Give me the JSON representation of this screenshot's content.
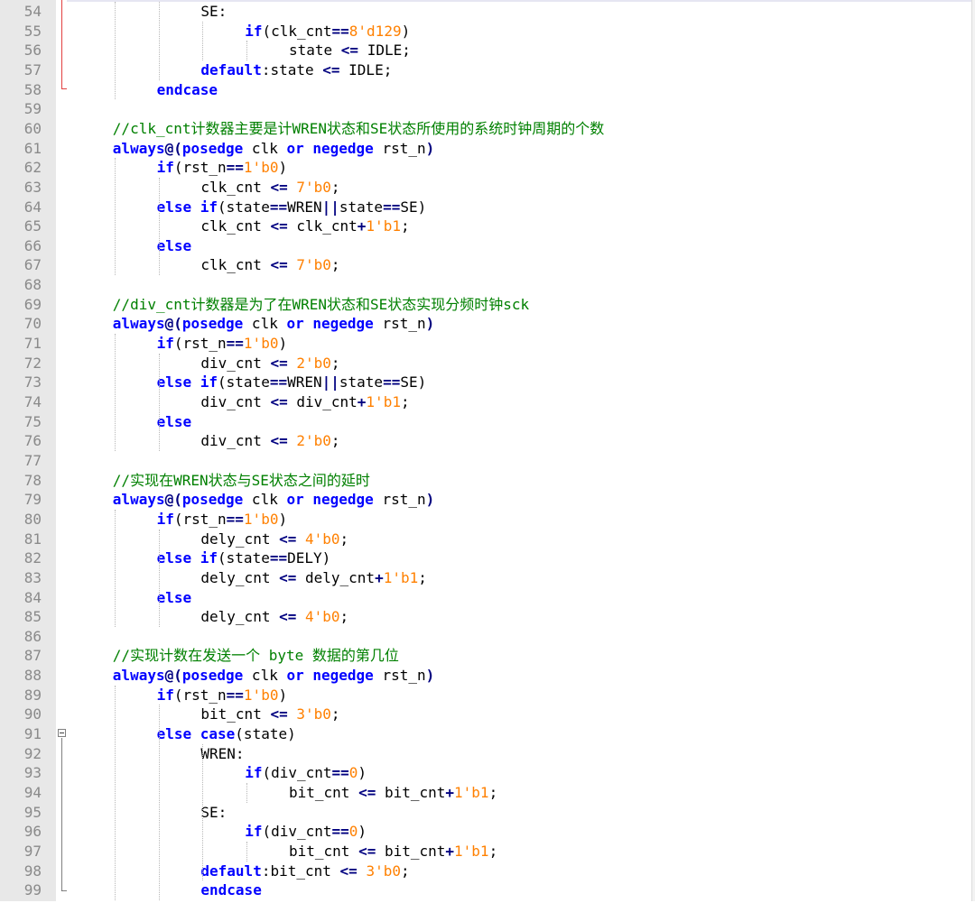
{
  "editor": {
    "language": "Verilog",
    "colors": {
      "keyword": "#0000ff",
      "operator": "#000080",
      "number": "#ff8000",
      "comment": "#008000",
      "line_number": "#8a8a8a",
      "gutter_bg": "#e8e8e8"
    },
    "lines": [
      {
        "n": "54",
        "indent": 6,
        "tokens": [
          {
            "t": "SE:",
            "c": "id"
          }
        ]
      },
      {
        "n": "55",
        "indent": 8,
        "tokens": [
          {
            "t": "if",
            "c": "kw"
          },
          {
            "t": "(clk_cnt",
            "c": "id"
          },
          {
            "t": "==",
            "c": "op"
          },
          {
            "t": "8'd129",
            "c": "num"
          },
          {
            "t": ")",
            "c": "id"
          }
        ]
      },
      {
        "n": "56",
        "indent": 10,
        "tokens": [
          {
            "t": "state ",
            "c": "id"
          },
          {
            "t": "<=",
            "c": "op"
          },
          {
            "t": " IDLE;",
            "c": "id"
          }
        ]
      },
      {
        "n": "57",
        "indent": 6,
        "tokens": [
          {
            "t": "default",
            "c": "kw"
          },
          {
            "t": ":state ",
            "c": "id"
          },
          {
            "t": "<=",
            "c": "op"
          },
          {
            "t": " IDLE;",
            "c": "id"
          }
        ]
      },
      {
        "n": "58",
        "indent": 4,
        "tokens": [
          {
            "t": "endcase",
            "c": "kw"
          }
        ]
      },
      {
        "n": "59",
        "indent": 0,
        "tokens": []
      },
      {
        "n": "60",
        "indent": 2,
        "tokens": [
          {
            "t": "//clk_cnt计数器主要是计WREN状态和SE状态所使用的系统时钟周期的个数",
            "c": "cm"
          }
        ]
      },
      {
        "n": "61",
        "indent": 2,
        "tokens": [
          {
            "t": "always",
            "c": "kw"
          },
          {
            "t": "@(",
            "c": "op"
          },
          {
            "t": "posedge",
            "c": "kw"
          },
          {
            "t": " clk ",
            "c": "id"
          },
          {
            "t": "or",
            "c": "kw"
          },
          {
            "t": " ",
            "c": "id"
          },
          {
            "t": "negedge",
            "c": "kw"
          },
          {
            "t": " rst_n",
            "c": "id"
          },
          {
            "t": ")",
            "c": "op"
          }
        ]
      },
      {
        "n": "62",
        "indent": 4,
        "tokens": [
          {
            "t": "if",
            "c": "kw"
          },
          {
            "t": "(rst_n",
            "c": "id"
          },
          {
            "t": "==",
            "c": "op"
          },
          {
            "t": "1'b0",
            "c": "num"
          },
          {
            "t": ")",
            "c": "id"
          }
        ]
      },
      {
        "n": "63",
        "indent": 6,
        "tokens": [
          {
            "t": "clk_cnt ",
            "c": "id"
          },
          {
            "t": "<=",
            "c": "op"
          },
          {
            "t": " ",
            "c": "id"
          },
          {
            "t": "7'b0",
            "c": "num"
          },
          {
            "t": ";",
            "c": "id"
          }
        ]
      },
      {
        "n": "64",
        "indent": 4,
        "tokens": [
          {
            "t": "else",
            "c": "kw"
          },
          {
            "t": " ",
            "c": "id"
          },
          {
            "t": "if",
            "c": "kw"
          },
          {
            "t": "(state",
            "c": "id"
          },
          {
            "t": "==",
            "c": "op"
          },
          {
            "t": "WREN",
            "c": "id"
          },
          {
            "t": "||",
            "c": "op"
          },
          {
            "t": "state",
            "c": "id"
          },
          {
            "t": "==",
            "c": "op"
          },
          {
            "t": "SE)",
            "c": "id"
          }
        ]
      },
      {
        "n": "65",
        "indent": 6,
        "tokens": [
          {
            "t": "clk_cnt ",
            "c": "id"
          },
          {
            "t": "<=",
            "c": "op"
          },
          {
            "t": " clk_cnt",
            "c": "id"
          },
          {
            "t": "+",
            "c": "op"
          },
          {
            "t": "1'b1",
            "c": "num"
          },
          {
            "t": ";",
            "c": "id"
          }
        ]
      },
      {
        "n": "66",
        "indent": 4,
        "tokens": [
          {
            "t": "else",
            "c": "kw"
          }
        ]
      },
      {
        "n": "67",
        "indent": 6,
        "tokens": [
          {
            "t": "clk_cnt ",
            "c": "id"
          },
          {
            "t": "<=",
            "c": "op"
          },
          {
            "t": " ",
            "c": "id"
          },
          {
            "t": "7'b0",
            "c": "num"
          },
          {
            "t": ";",
            "c": "id"
          }
        ]
      },
      {
        "n": "68",
        "indent": 0,
        "tokens": []
      },
      {
        "n": "69",
        "indent": 2,
        "tokens": [
          {
            "t": "//div_cnt计数器是为了在WREN状态和SE状态实现分频时钟sck",
            "c": "cm"
          }
        ]
      },
      {
        "n": "70",
        "indent": 2,
        "tokens": [
          {
            "t": "always",
            "c": "kw"
          },
          {
            "t": "@(",
            "c": "op"
          },
          {
            "t": "posedge",
            "c": "kw"
          },
          {
            "t": " clk ",
            "c": "id"
          },
          {
            "t": "or",
            "c": "kw"
          },
          {
            "t": " ",
            "c": "id"
          },
          {
            "t": "negedge",
            "c": "kw"
          },
          {
            "t": " rst_n",
            "c": "id"
          },
          {
            "t": ")",
            "c": "op"
          }
        ]
      },
      {
        "n": "71",
        "indent": 4,
        "tokens": [
          {
            "t": "if",
            "c": "kw"
          },
          {
            "t": "(rst_n",
            "c": "id"
          },
          {
            "t": "==",
            "c": "op"
          },
          {
            "t": "1'b0",
            "c": "num"
          },
          {
            "t": ")",
            "c": "id"
          }
        ]
      },
      {
        "n": "72",
        "indent": 6,
        "tokens": [
          {
            "t": "div_cnt ",
            "c": "id"
          },
          {
            "t": "<=",
            "c": "op"
          },
          {
            "t": " ",
            "c": "id"
          },
          {
            "t": "2'b0",
            "c": "num"
          },
          {
            "t": ";",
            "c": "id"
          }
        ]
      },
      {
        "n": "73",
        "indent": 4,
        "tokens": [
          {
            "t": "else",
            "c": "kw"
          },
          {
            "t": " ",
            "c": "id"
          },
          {
            "t": "if",
            "c": "kw"
          },
          {
            "t": "(state",
            "c": "id"
          },
          {
            "t": "==",
            "c": "op"
          },
          {
            "t": "WREN",
            "c": "id"
          },
          {
            "t": "||",
            "c": "op"
          },
          {
            "t": "state",
            "c": "id"
          },
          {
            "t": "==",
            "c": "op"
          },
          {
            "t": "SE)",
            "c": "id"
          }
        ]
      },
      {
        "n": "74",
        "indent": 6,
        "tokens": [
          {
            "t": "div_cnt ",
            "c": "id"
          },
          {
            "t": "<=",
            "c": "op"
          },
          {
            "t": " div_cnt",
            "c": "id"
          },
          {
            "t": "+",
            "c": "op"
          },
          {
            "t": "1'b1",
            "c": "num"
          },
          {
            "t": ";",
            "c": "id"
          }
        ]
      },
      {
        "n": "75",
        "indent": 4,
        "tokens": [
          {
            "t": "else",
            "c": "kw"
          }
        ]
      },
      {
        "n": "76",
        "indent": 6,
        "tokens": [
          {
            "t": "div_cnt ",
            "c": "id"
          },
          {
            "t": "<=",
            "c": "op"
          },
          {
            "t": " ",
            "c": "id"
          },
          {
            "t": "2'b0",
            "c": "num"
          },
          {
            "t": ";",
            "c": "id"
          }
        ]
      },
      {
        "n": "77",
        "indent": 0,
        "tokens": []
      },
      {
        "n": "78",
        "indent": 2,
        "tokens": [
          {
            "t": "//实现在WREN状态与SE状态之间的延时",
            "c": "cm"
          }
        ]
      },
      {
        "n": "79",
        "indent": 2,
        "tokens": [
          {
            "t": "always",
            "c": "kw"
          },
          {
            "t": "@(",
            "c": "op"
          },
          {
            "t": "posedge",
            "c": "kw"
          },
          {
            "t": " clk ",
            "c": "id"
          },
          {
            "t": "or",
            "c": "kw"
          },
          {
            "t": " ",
            "c": "id"
          },
          {
            "t": "negedge",
            "c": "kw"
          },
          {
            "t": " rst_n",
            "c": "id"
          },
          {
            "t": ")",
            "c": "op"
          }
        ]
      },
      {
        "n": "80",
        "indent": 4,
        "tokens": [
          {
            "t": "if",
            "c": "kw"
          },
          {
            "t": "(rst_n",
            "c": "id"
          },
          {
            "t": "==",
            "c": "op"
          },
          {
            "t": "1'b0",
            "c": "num"
          },
          {
            "t": ")",
            "c": "id"
          }
        ]
      },
      {
        "n": "81",
        "indent": 6,
        "tokens": [
          {
            "t": "dely_cnt ",
            "c": "id"
          },
          {
            "t": "<=",
            "c": "op"
          },
          {
            "t": " ",
            "c": "id"
          },
          {
            "t": "4'b0",
            "c": "num"
          },
          {
            "t": ";",
            "c": "id"
          }
        ]
      },
      {
        "n": "82",
        "indent": 4,
        "tokens": [
          {
            "t": "else",
            "c": "kw"
          },
          {
            "t": " ",
            "c": "id"
          },
          {
            "t": "if",
            "c": "kw"
          },
          {
            "t": "(state",
            "c": "id"
          },
          {
            "t": "==",
            "c": "op"
          },
          {
            "t": "DELY)",
            "c": "id"
          }
        ]
      },
      {
        "n": "83",
        "indent": 6,
        "tokens": [
          {
            "t": "dely_cnt ",
            "c": "id"
          },
          {
            "t": "<=",
            "c": "op"
          },
          {
            "t": " dely_cnt",
            "c": "id"
          },
          {
            "t": "+",
            "c": "op"
          },
          {
            "t": "1'b1",
            "c": "num"
          },
          {
            "t": ";",
            "c": "id"
          }
        ]
      },
      {
        "n": "84",
        "indent": 4,
        "tokens": [
          {
            "t": "else",
            "c": "kw"
          }
        ]
      },
      {
        "n": "85",
        "indent": 6,
        "tokens": [
          {
            "t": "dely_cnt ",
            "c": "id"
          },
          {
            "t": "<=",
            "c": "op"
          },
          {
            "t": " ",
            "c": "id"
          },
          {
            "t": "4'b0",
            "c": "num"
          },
          {
            "t": ";",
            "c": "id"
          }
        ]
      },
      {
        "n": "86",
        "indent": 0,
        "tokens": []
      },
      {
        "n": "87",
        "indent": 2,
        "tokens": [
          {
            "t": "//实现计数在发送一个 byte 数据的第几位",
            "c": "cm"
          }
        ]
      },
      {
        "n": "88",
        "indent": 2,
        "tokens": [
          {
            "t": "always",
            "c": "kw"
          },
          {
            "t": "@(",
            "c": "op"
          },
          {
            "t": "posedge",
            "c": "kw"
          },
          {
            "t": " clk ",
            "c": "id"
          },
          {
            "t": "or",
            "c": "kw"
          },
          {
            "t": " ",
            "c": "id"
          },
          {
            "t": "negedge",
            "c": "kw"
          },
          {
            "t": " rst_n",
            "c": "id"
          },
          {
            "t": ")",
            "c": "op"
          }
        ]
      },
      {
        "n": "89",
        "indent": 4,
        "tokens": [
          {
            "t": "if",
            "c": "kw"
          },
          {
            "t": "(rst_n",
            "c": "id"
          },
          {
            "t": "==",
            "c": "op"
          },
          {
            "t": "1'b0",
            "c": "num"
          },
          {
            "t": ")",
            "c": "id"
          }
        ]
      },
      {
        "n": "90",
        "indent": 6,
        "tokens": [
          {
            "t": "bit_cnt ",
            "c": "id"
          },
          {
            "t": "<=",
            "c": "op"
          },
          {
            "t": " ",
            "c": "id"
          },
          {
            "t": "3'b0",
            "c": "num"
          },
          {
            "t": ";",
            "c": "id"
          }
        ]
      },
      {
        "n": "91",
        "indent": 4,
        "tokens": [
          {
            "t": "else",
            "c": "kw"
          },
          {
            "t": " ",
            "c": "id"
          },
          {
            "t": "case",
            "c": "kw"
          },
          {
            "t": "(state)",
            "c": "id"
          }
        ]
      },
      {
        "n": "92",
        "indent": 6,
        "tokens": [
          {
            "t": "WREN:",
            "c": "id"
          }
        ]
      },
      {
        "n": "93",
        "indent": 8,
        "tokens": [
          {
            "t": "if",
            "c": "kw"
          },
          {
            "t": "(div_cnt",
            "c": "id"
          },
          {
            "t": "==",
            "c": "op"
          },
          {
            "t": "0",
            "c": "num"
          },
          {
            "t": ")",
            "c": "id"
          }
        ]
      },
      {
        "n": "94",
        "indent": 10,
        "tokens": [
          {
            "t": "bit_cnt ",
            "c": "id"
          },
          {
            "t": "<=",
            "c": "op"
          },
          {
            "t": " bit_cnt",
            "c": "id"
          },
          {
            "t": "+",
            "c": "op"
          },
          {
            "t": "1'b1",
            "c": "num"
          },
          {
            "t": ";",
            "c": "id"
          }
        ]
      },
      {
        "n": "95",
        "indent": 6,
        "tokens": [
          {
            "t": "SE:",
            "c": "id"
          }
        ]
      },
      {
        "n": "96",
        "indent": 8,
        "tokens": [
          {
            "t": "if",
            "c": "kw"
          },
          {
            "t": "(div_cnt",
            "c": "id"
          },
          {
            "t": "==",
            "c": "op"
          },
          {
            "t": "0",
            "c": "num"
          },
          {
            "t": ")",
            "c": "id"
          }
        ]
      },
      {
        "n": "97",
        "indent": 10,
        "tokens": [
          {
            "t": "bit_cnt ",
            "c": "id"
          },
          {
            "t": "<=",
            "c": "op"
          },
          {
            "t": " bit_cnt",
            "c": "id"
          },
          {
            "t": "+",
            "c": "op"
          },
          {
            "t": "1'b1",
            "c": "num"
          },
          {
            "t": ";",
            "c": "id"
          }
        ]
      },
      {
        "n": "98",
        "indent": 6,
        "tokens": [
          {
            "t": "default",
            "c": "kw"
          },
          {
            "t": ":bit_cnt ",
            "c": "id"
          },
          {
            "t": "<=",
            "c": "op"
          },
          {
            "t": " ",
            "c": "id"
          },
          {
            "t": "3'b0",
            "c": "num"
          },
          {
            "t": ";",
            "c": "id"
          }
        ]
      },
      {
        "n": "99",
        "indent": 6,
        "tokens": [
          {
            "t": "endcase",
            "c": "kw"
          }
        ]
      }
    ]
  }
}
